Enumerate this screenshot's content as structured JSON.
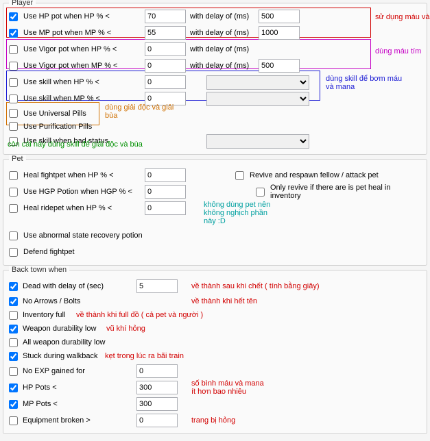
{
  "player": {
    "title": "Player",
    "hp_pot": {
      "label": "Use HP pot when HP % <",
      "checked": true,
      "value": "70",
      "delay_label": "with delay of (ms)",
      "delay": "500"
    },
    "mp_pot": {
      "label": "Use MP pot when MP % <",
      "checked": true,
      "value": "55",
      "delay_label": "with delay of (ms)",
      "delay": "1000"
    },
    "vigor_hp": {
      "label": "Use Vigor pot when HP % <",
      "checked": false,
      "value": "0",
      "delay_label": "with delay of (ms)"
    },
    "vigor_mp": {
      "label": "Use Vigor pot when MP % <",
      "checked": false,
      "value": "0",
      "delay_label": "with delay of (ms)",
      "delay": "500"
    },
    "skill_hp": {
      "label": "Use skill when HP % <",
      "checked": false,
      "value": "0"
    },
    "skill_mp": {
      "label": "Use skill when MP % <",
      "checked": false,
      "value": "0"
    },
    "univ_pills": {
      "label": "Use Universal Pills",
      "checked": false
    },
    "purif_pills": {
      "label": "Use Purification Pills",
      "checked": false
    },
    "skill_bad": {
      "label": "Use skill when bad status",
      "checked": false
    }
  },
  "pet": {
    "title": "Pet",
    "heal_fight": {
      "label": "Heal fightpet when HP % <",
      "checked": false,
      "value": "0"
    },
    "hgp": {
      "label": "Use HGP Potion when HGP % <",
      "checked": false,
      "value": "0"
    },
    "heal_ride": {
      "label": "Heal ridepet when HP % <",
      "checked": false,
      "value": "0"
    },
    "revive_fellow": {
      "label": "Revive and respawn fellow / attack pet",
      "checked": false
    },
    "only_revive": {
      "label": "Only revive if there are is pet heal in inventory",
      "checked": false
    },
    "abnormal": {
      "label": "Use abnormal state recovery potion",
      "checked": false
    },
    "defend": {
      "label": "Defend fightpet",
      "checked": false
    }
  },
  "backtown": {
    "title": "Back town when",
    "dead": {
      "label": "Dead with delay of (sec)",
      "checked": true,
      "value": "5"
    },
    "no_arrows": {
      "label": "No Arrows / Bolts",
      "checked": true
    },
    "inv_full": {
      "label": "Inventory full",
      "checked": false
    },
    "weapon_dur": {
      "label": "Weapon durability low",
      "checked": true
    },
    "all_weapon_dur": {
      "label": "All weapon durability low",
      "checked": false
    },
    "stuck": {
      "label": "Stuck during walkback",
      "checked": true
    },
    "no_exp": {
      "label": "No EXP gained for",
      "checked": false,
      "value": "0"
    },
    "hp_pots": {
      "label": "HP Pots <",
      "checked": true,
      "value": "300"
    },
    "mp_pots": {
      "label": "MP Pots <",
      "checked": true,
      "value": "300"
    },
    "equip_broken": {
      "label": "Equipment broken >",
      "checked": false,
      "value": "0"
    }
  },
  "annotations": {
    "hpmana": "sử dụng máu và mana",
    "vigor": "dùng máu tím",
    "skill": "dùng skill để bơm máu\nvà mana",
    "pills": "dùng giải độc và giải\nbùa",
    "badskill": "còn cái này dùng skill để giải độc và bùa",
    "pet_note": "không dùng pet nên\nkhông nghịch phần\nnày :D",
    "dead": "về thành sau khi chết ( tính bằng giây)",
    "arrows": "về thành khi hết tên",
    "inv": "về thành khi full đồ ( cả pet và người )",
    "weapon": "vũ khí hỏng",
    "stuck": "kẹt trong lúc ra bãi train",
    "pots": "số bình máu và mana\nít hơn bao nhiêu",
    "equip": "trang bị hỏng"
  }
}
